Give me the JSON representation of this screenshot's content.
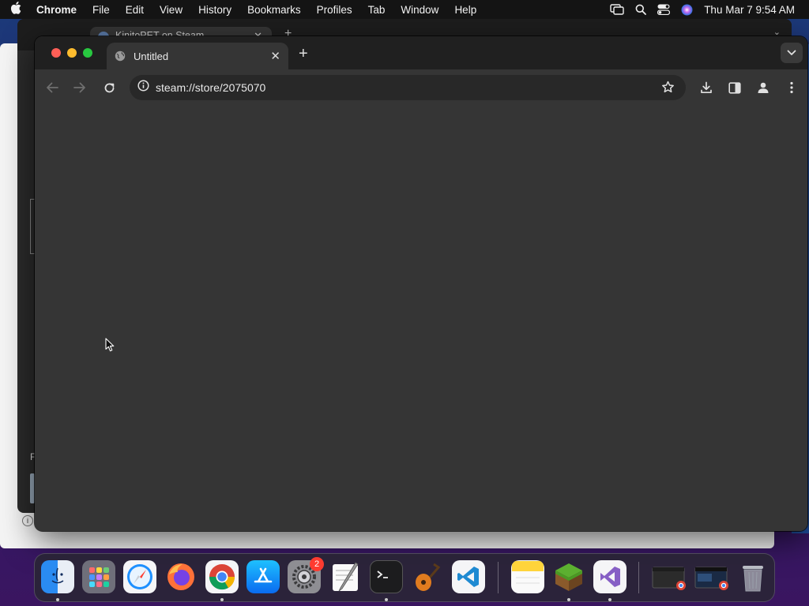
{
  "menubar": {
    "app_name": "Chrome",
    "menus": [
      "File",
      "Edit",
      "View",
      "History",
      "Bookmarks",
      "Profiles",
      "Tab",
      "Window",
      "Help"
    ],
    "clock": "Thu Mar 7  9:54 AM"
  },
  "background_window": {
    "tab_title": "KinitoPET on Steam",
    "strip_letter": "F"
  },
  "browser": {
    "tab_title": "Untitled",
    "url": "steam://store/2075070"
  },
  "dock": {
    "settings_badge": "2"
  }
}
